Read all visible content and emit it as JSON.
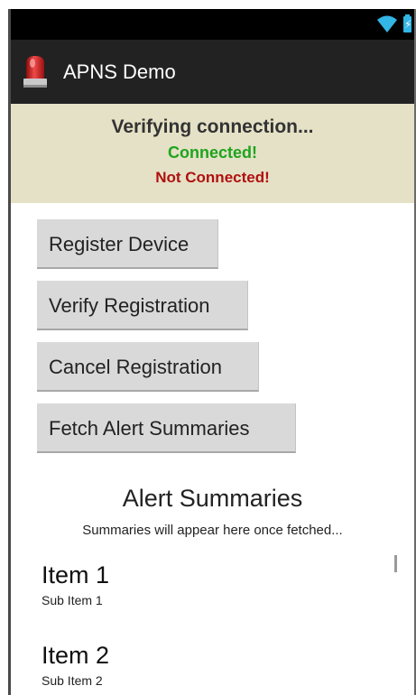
{
  "app": {
    "title": "APNS Demo"
  },
  "status": {
    "verifying": "Verifying connection...",
    "connected": "Connected!",
    "not_connected": "Not Connected!"
  },
  "buttons": {
    "register": "Register Device",
    "verify": "Verify Registration",
    "cancel": "Cancel Registration",
    "fetch": "Fetch Alert Summaries"
  },
  "summaries": {
    "title": "Alert Summaries",
    "hint": "Summaries will appear here once fetched...",
    "items": [
      {
        "title": "Item 1",
        "subtitle": "Sub Item 1"
      },
      {
        "title": "Item 2",
        "subtitle": "Sub Item 2"
      }
    ]
  },
  "icons": {
    "wifi": "wifi-icon",
    "battery": "battery-charging-icon",
    "app": "alarm-siren-icon"
  },
  "colors": {
    "actionbar": "#222222",
    "status_panel": "#e5e1c6",
    "connected": "#1ea41e",
    "not_connected": "#b01010",
    "battery_accent": "#33b5e5"
  }
}
